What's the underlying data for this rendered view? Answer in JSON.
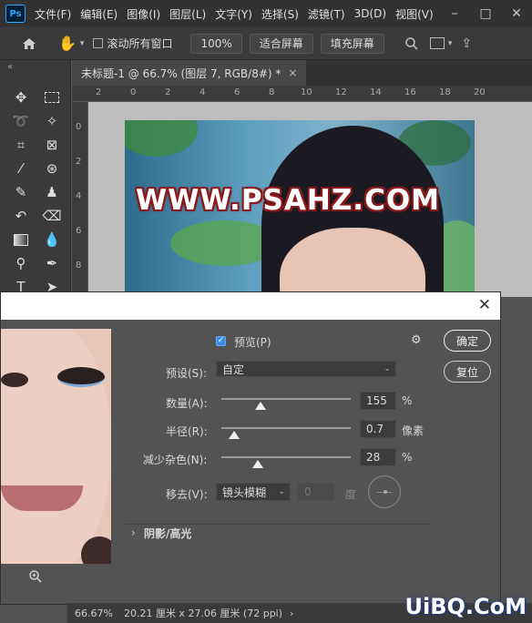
{
  "app": {
    "logo": "Ps"
  },
  "menu": [
    "文件(F)",
    "编辑(E)",
    "图像(I)",
    "图层(L)",
    "文字(Y)",
    "选择(S)",
    "滤镜(T)",
    "3D(D)",
    "视图(V)"
  ],
  "options": {
    "scroll_all_label": "滚动所有窗口",
    "zoom": "100%",
    "fit_screen": "适合屏幕",
    "fill_screen": "填充屏幕"
  },
  "document": {
    "tab_title": "未标题-1 @ 66.7% (图层 7, RGB/8#) *",
    "tab_close": "×",
    "watermark_text": "WWW.PSAHZ.COM"
  },
  "rulers": {
    "h_ticks": [
      "2",
      "0",
      "2",
      "4",
      "6",
      "8",
      "10",
      "12",
      "14",
      "16",
      "18",
      "20"
    ],
    "v_ticks": [
      "0",
      "2",
      "4",
      "6",
      "8"
    ]
  },
  "dialog": {
    "preview_label": "预览(P)",
    "preview_checked": true,
    "preset_label": "预设(S):",
    "preset_value": "自定",
    "amount_label": "数量(A):",
    "amount_value": "155",
    "amount_unit": "%",
    "amount_level": 0.3,
    "radius_label": "半径(R):",
    "radius_value": "0.7",
    "radius_unit": "像素",
    "radius_level": 0.1,
    "noise_label": "减少杂色(N):",
    "noise_value": "28",
    "noise_unit": "%",
    "noise_level": 0.28,
    "remove_label": "移去(V):",
    "remove_value": "镜头模糊",
    "angle_value": "0",
    "angle_unit": "度",
    "shadow_section": "阴影/高光",
    "ok_button": "确定",
    "reset_button": "复位"
  },
  "status": {
    "zoom": "66.67%",
    "doc_size": "20.21 厘米 x 27.06 厘米 (72 ppi)",
    "arrow": "›"
  },
  "corner_logo": "UiBQ.CoM"
}
